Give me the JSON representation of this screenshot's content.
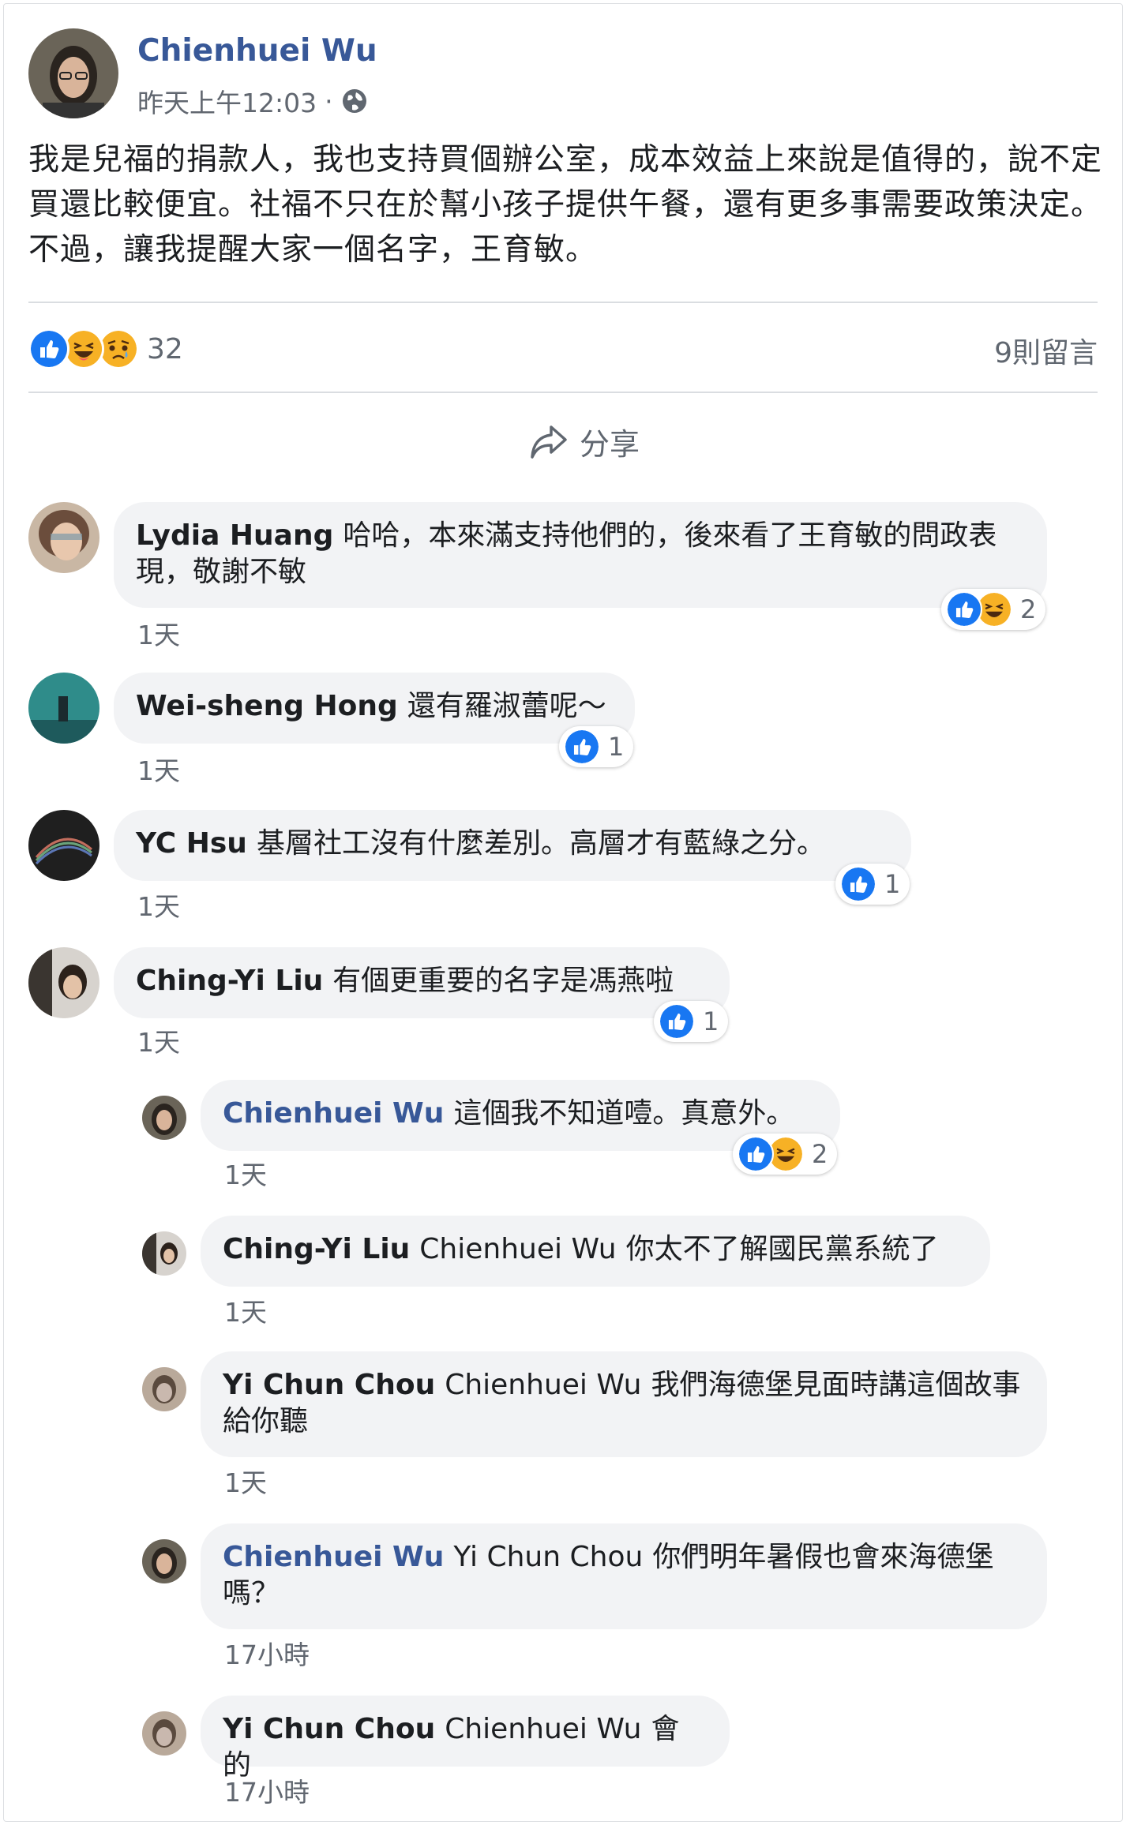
{
  "post": {
    "author": "Chienhuei Wu",
    "time": "昨天上午12:03",
    "separator": "·",
    "text": "我是兒福的捐款人，我也支持買個辦公室，成本效益上來說是值得的，說不定買還比較便宜。社福不只在於幫小孩子提供午餐，還有更多事需要政策決定。不過，讓我提醒大家一個名字，王育敏。",
    "reaction_count": "32",
    "comment_count": "9則留言",
    "share_label": "分享"
  },
  "icons": {
    "privacy": "globe-icon",
    "share": "share-arrow-icon",
    "like": "like-icon",
    "haha": "haha-icon",
    "sad": "sad-icon"
  },
  "colors": {
    "link": "#385898",
    "like": "#1877f2",
    "haha": "#f7b125",
    "bubble": "#f2f3f5",
    "meta": "#616770"
  },
  "comments": [
    {
      "name": "Lydia Huang",
      "text": "哈哈，本來滿支持他們的，後來看了王育敏的問政表現，敬謝不敏",
      "time": "1天",
      "reactions": "2"
    },
    {
      "name": "Wei-sheng Hong",
      "text": "還有羅淑蕾呢～",
      "time": "1天",
      "reactions": "1"
    },
    {
      "name": "YC Hsu",
      "text": "基層社工沒有什麼差別。高層才有藍綠之分。",
      "time": "1天",
      "reactions": "1"
    },
    {
      "name": "Ching-Yi Liu",
      "text": "有個更重要的名字是馮燕啦",
      "time": "1天",
      "reactions": "1"
    }
  ],
  "replies": [
    {
      "name": "Chienhuei Wu",
      "tag": "",
      "text": "這個我不知道噎。真意外。",
      "time": "1天",
      "reactions": "2"
    },
    {
      "name": "Ching-Yi Liu",
      "tag": "Chienhuei Wu",
      "text": "你太不了解國民黨系統了",
      "time": "1天"
    },
    {
      "name": "Yi Chun Chou",
      "tag": "Chienhuei Wu",
      "text": "我們海德堡見面時講這個故事給你聽",
      "time": "1天"
    },
    {
      "name": "Chienhuei Wu",
      "tag": "Yi Chun Chou",
      "text": "你們明年暑假也會來海德堡嗎？",
      "time": "17小時"
    },
    {
      "name": "Yi Chun Chou",
      "tag": "Chienhuei Wu",
      "text": "會的",
      "time": "17小時"
    }
  ]
}
